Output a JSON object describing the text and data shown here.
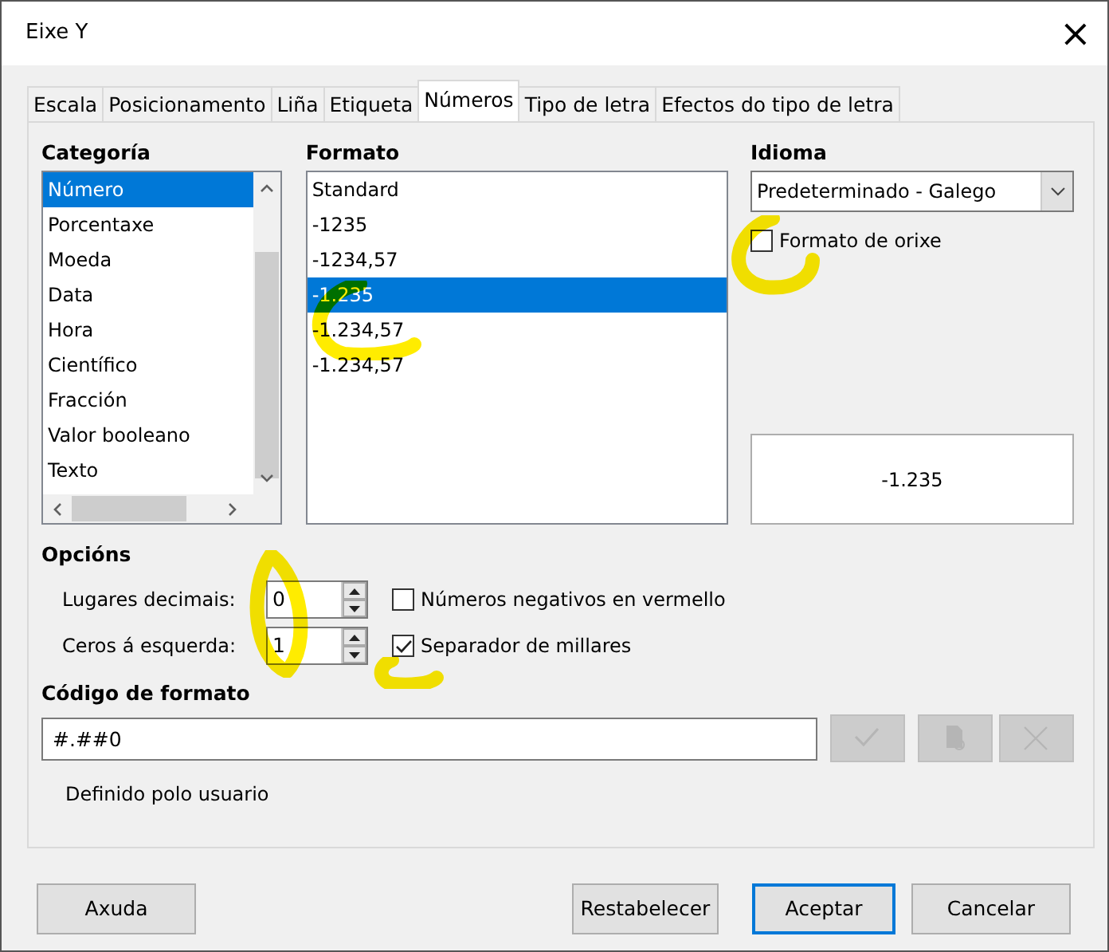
{
  "window": {
    "title": "Eixe Y",
    "close": "×"
  },
  "tabs": [
    {
      "label": "Escala",
      "selected": false
    },
    {
      "label": "Posicionamento",
      "selected": false
    },
    {
      "label": "Liña",
      "selected": false
    },
    {
      "label": "Etiqueta",
      "selected": false
    },
    {
      "label": "Números",
      "selected": true
    },
    {
      "label": "Tipo de letra",
      "selected": false
    },
    {
      "label": "Efectos do tipo de letra",
      "selected": false
    }
  ],
  "category": {
    "label": "Categoría",
    "items": [
      {
        "label": "Número",
        "selected": true
      },
      {
        "label": "Porcentaxe",
        "selected": false
      },
      {
        "label": "Moeda",
        "selected": false
      },
      {
        "label": "Data",
        "selected": false
      },
      {
        "label": "Hora",
        "selected": false
      },
      {
        "label": "Científico",
        "selected": false
      },
      {
        "label": "Fracción",
        "selected": false
      },
      {
        "label": "Valor booleano",
        "selected": false
      },
      {
        "label": "Texto",
        "selected": false
      }
    ]
  },
  "format": {
    "label": "Formato",
    "items": [
      {
        "label": "Standard",
        "selected": false
      },
      {
        "label": "-1235",
        "selected": false
      },
      {
        "label": "-1234,57",
        "selected": false
      },
      {
        "label": "-1.235",
        "selected": true
      },
      {
        "label": "-1.234,57",
        "selected": false
      },
      {
        "label": "-1.234,57",
        "selected": false
      }
    ]
  },
  "language": {
    "label": "Idioma",
    "value": "Predeterminado - Galego",
    "source_format": {
      "label": "Formato de orixe",
      "checked": false
    },
    "preview": "-1.235"
  },
  "options": {
    "label": "Opcións",
    "decimal_places": {
      "label": "Lugares decimais:",
      "value": "0"
    },
    "leading_zeros": {
      "label": "Ceros á esquerda:",
      "value": "1"
    },
    "negative_red": {
      "label": "Números negativos en vermello",
      "checked": false
    },
    "thousands_separator": {
      "label": "Separador de millares",
      "checked": true
    }
  },
  "format_code": {
    "label": "Código de formato",
    "value": "#.##0",
    "note": "Definido polo usuario"
  },
  "buttons": [
    {
      "label": "Axuda",
      "default": false
    },
    {
      "label": "Restabelecer",
      "default": false
    },
    {
      "label": "Aceptar",
      "default": true
    },
    {
      "label": "Cancelar",
      "default": false
    }
  ]
}
